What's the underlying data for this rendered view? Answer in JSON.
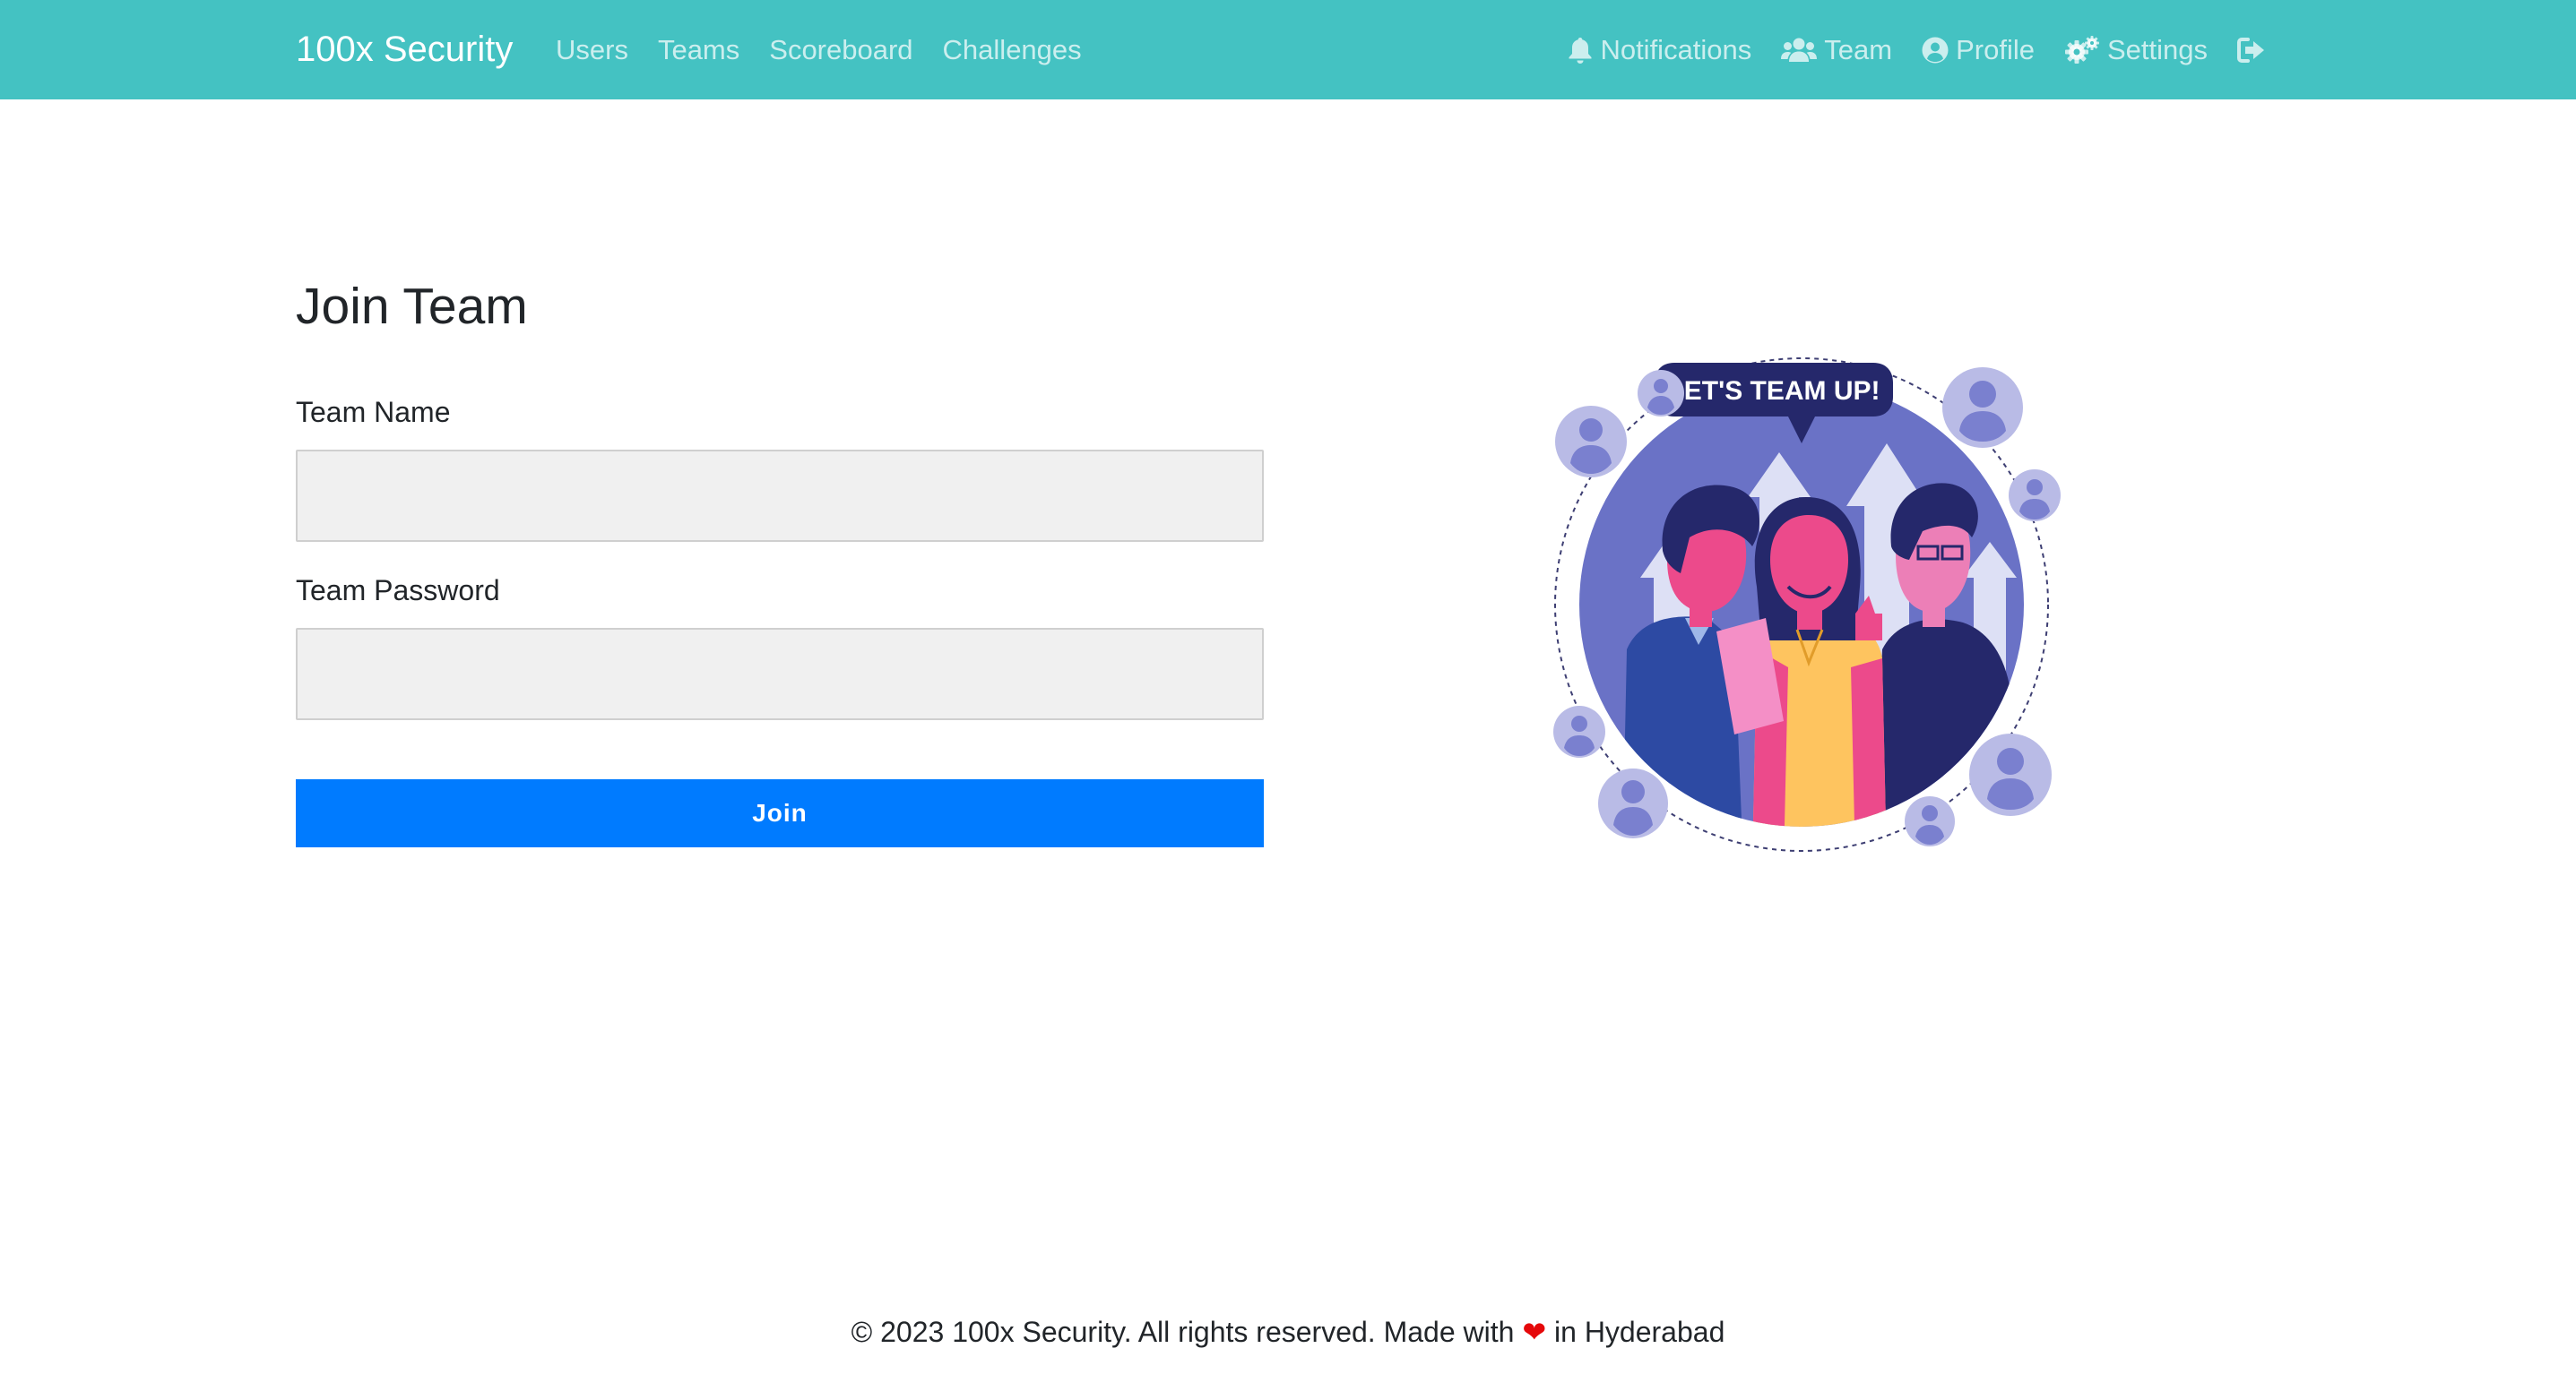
{
  "navbar": {
    "brand": "100x Security",
    "left_links": [
      {
        "label": "Users"
      },
      {
        "label": "Teams"
      },
      {
        "label": "Scoreboard"
      },
      {
        "label": "Challenges"
      }
    ],
    "right_links": [
      {
        "label": "Notifications",
        "icon": "bell-icon"
      },
      {
        "label": "Team",
        "icon": "users-icon"
      },
      {
        "label": "Profile",
        "icon": "user-circle-icon"
      },
      {
        "label": "Settings",
        "icon": "cogs-icon"
      }
    ],
    "logout_icon": "sign-out-icon",
    "background_color": "#44c2c2"
  },
  "main": {
    "title": "Join Team",
    "form": {
      "team_name_label": "Team Name",
      "team_name_value": "",
      "team_password_label": "Team Password",
      "team_password_value": "",
      "submit_label": "Join",
      "submit_color": "#007bff"
    },
    "illustration": {
      "speech_text": "LET'S TEAM UP!"
    }
  },
  "footer": {
    "text_before": "© 2023 100x Security. All rights reserved. Made with ",
    "heart": "❤",
    "text_after": " in Hyderabad"
  }
}
